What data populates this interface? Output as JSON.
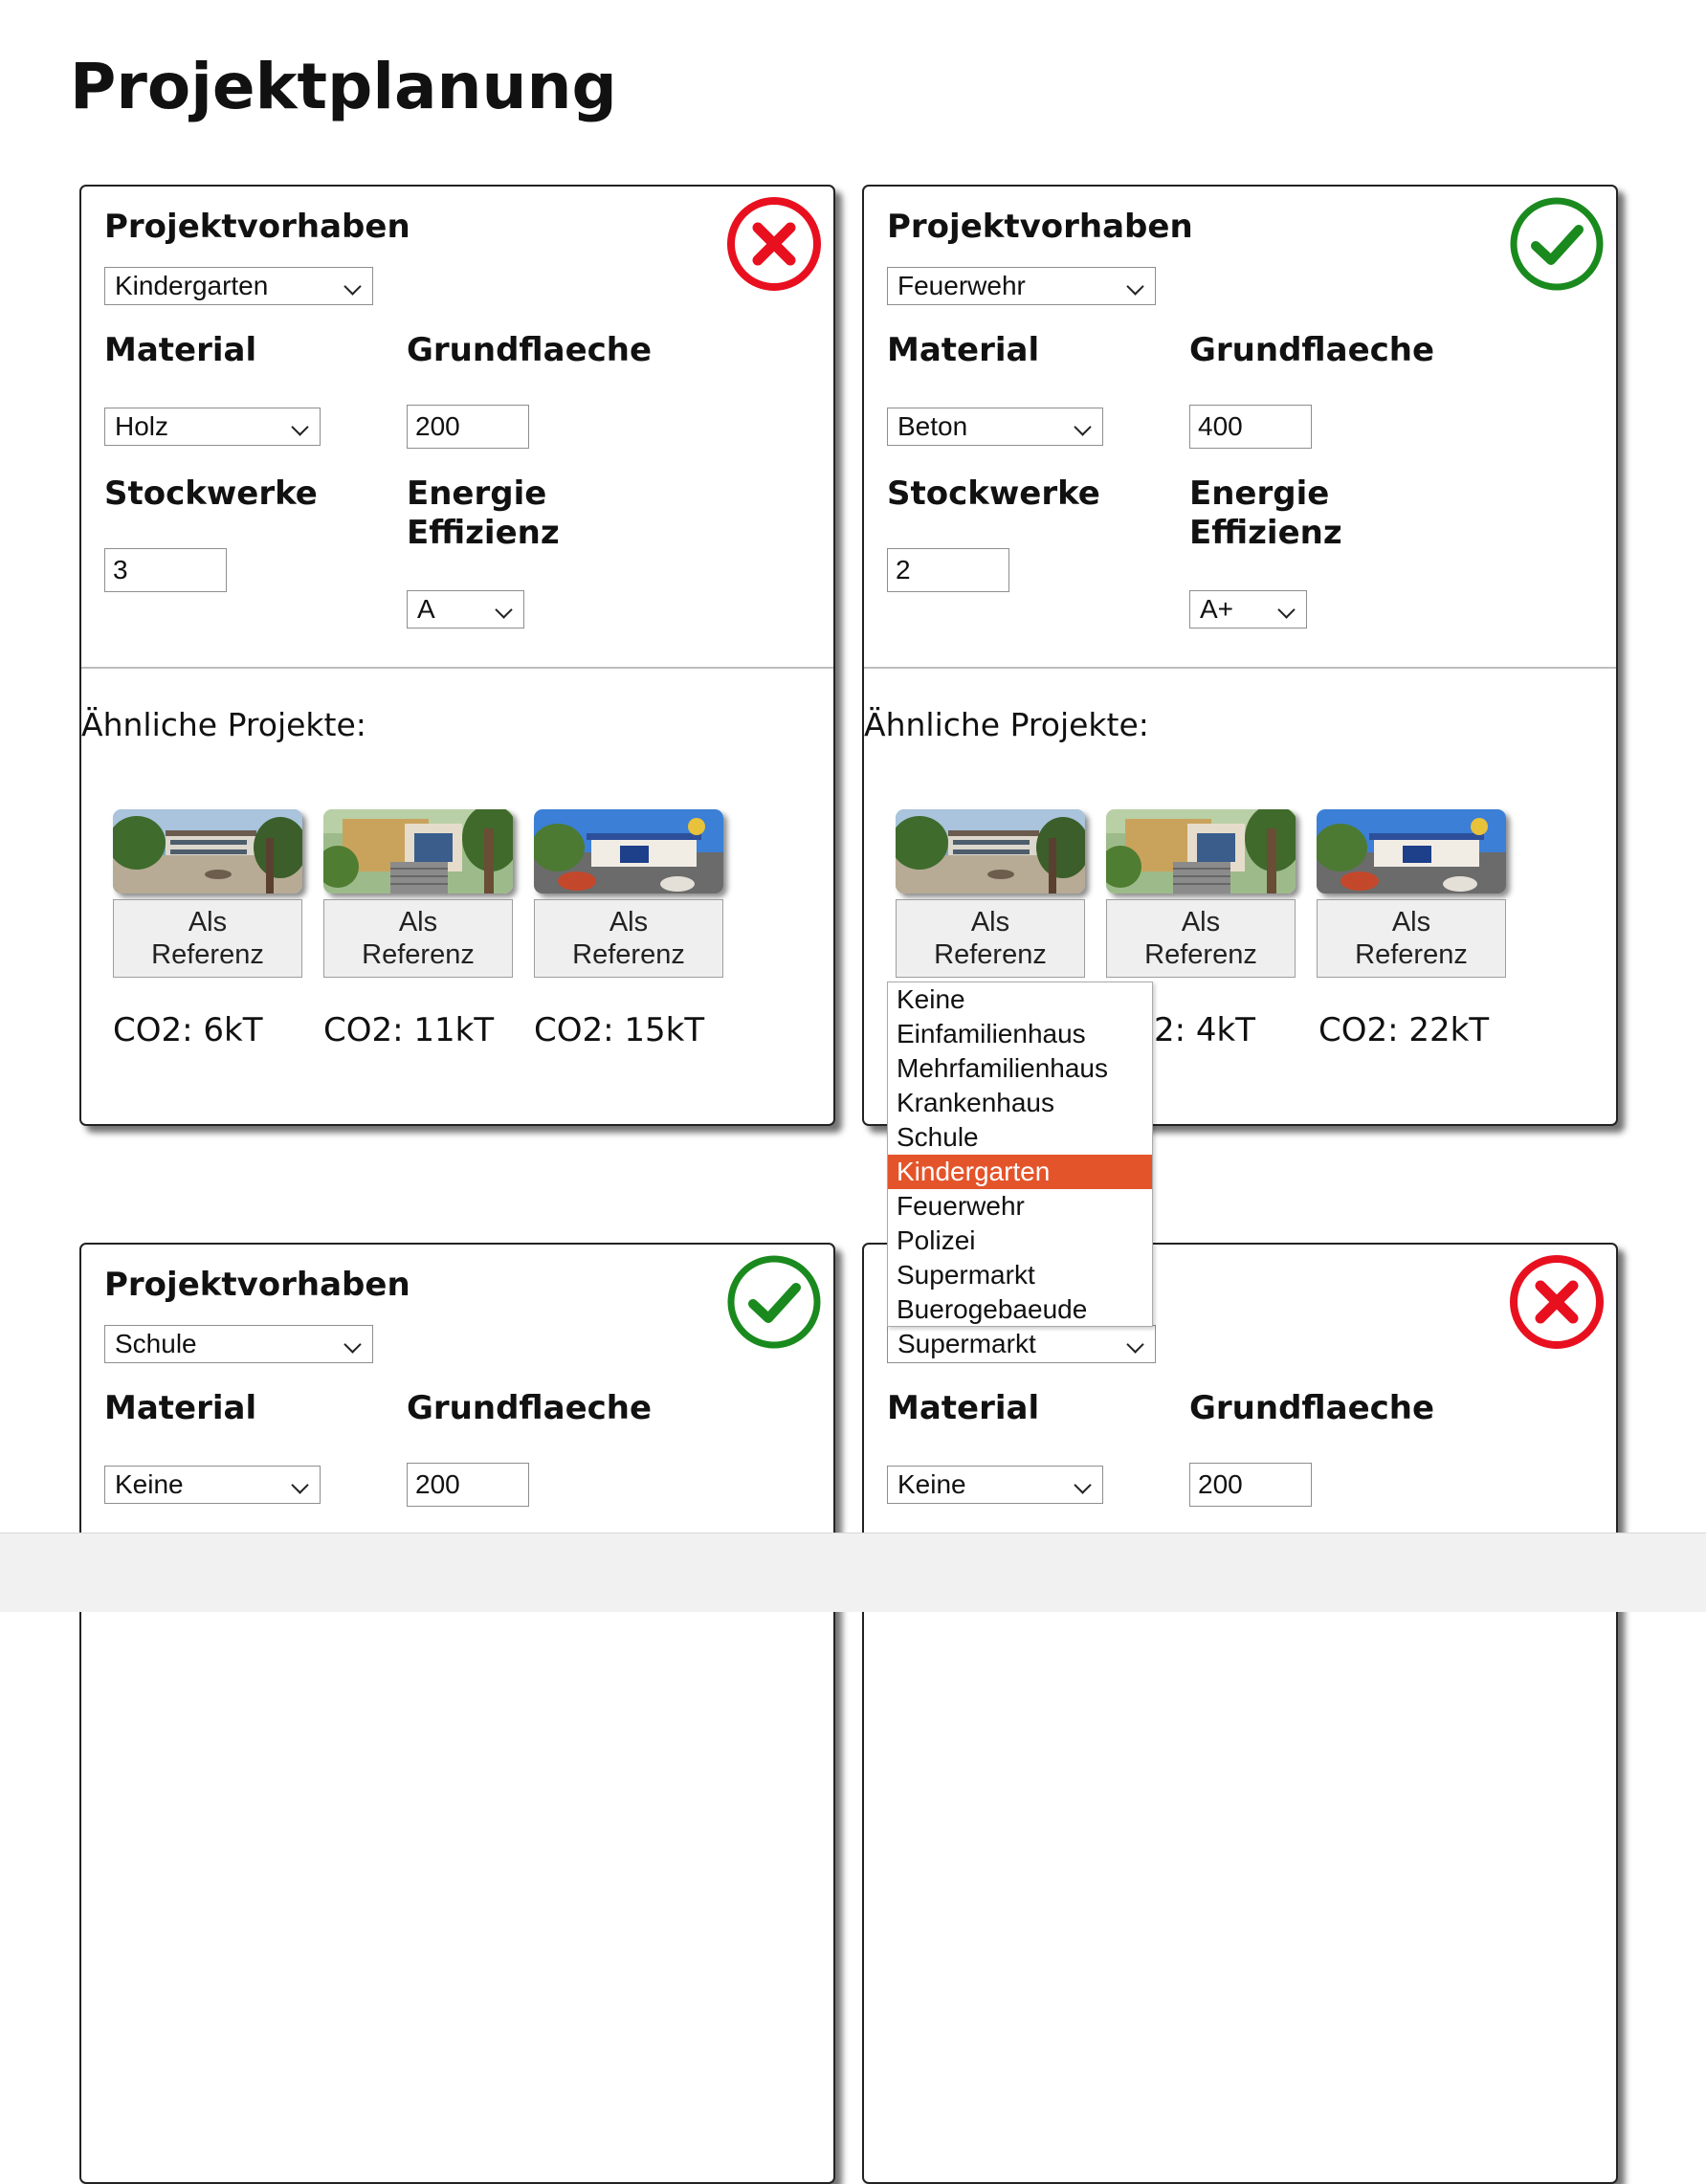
{
  "page": {
    "title": "Projektplanung"
  },
  "labels": {
    "projektvorhaben": "Projektvorhaben",
    "material": "Material",
    "grundflaeche": "Grundflaeche",
    "stockwerke": "Stockwerke",
    "energie_line1": "Energie",
    "energie_line2": "Effizienz",
    "similar": "Ähnliche Projekte:",
    "ref_button_line1": "Als",
    "ref_button_line2": "Referenz"
  },
  "cards": [
    {
      "status": "invalid",
      "status_icon": "x-circle-icon",
      "status_color": "#e8101f",
      "projektvorhaben": "Kindergarten",
      "material": "Holz",
      "grundflaeche": "200",
      "stockwerke": "3",
      "energie": "A",
      "co2": [
        "CO2: 6kT",
        "CO2: 11kT",
        "CO2: 15kT"
      ]
    },
    {
      "status": "valid",
      "status_icon": "check-circle-icon",
      "status_color": "#1a8a1e",
      "projektvorhaben": "Feuerwehr",
      "material": "Beton",
      "grundflaeche": "400",
      "stockwerke": "2",
      "energie": "A+",
      "co2": [
        "2: 4kT",
        "CO2: 22kT"
      ]
    },
    {
      "status": "valid",
      "status_icon": "check-circle-icon",
      "status_color": "#1a8a1e",
      "projektvorhaben": "Schule",
      "material": "Keine",
      "grundflaeche": "200"
    },
    {
      "status": "invalid",
      "status_icon": "x-circle-icon",
      "status_color": "#e8101f",
      "projektvorhaben": "Supermarkt",
      "material": "Keine",
      "grundflaeche": "200"
    }
  ],
  "dropdown": {
    "options": [
      "Keine",
      "Einfamilienhaus",
      "Mehrfamilienhaus",
      "Krankenhaus",
      "Schule",
      "Kindergarten",
      "Feuerwehr",
      "Polizei",
      "Supermarkt",
      "Buerogebaeude"
    ],
    "highlighted": "Kindergarten",
    "highlight_color": "#e4542b"
  }
}
